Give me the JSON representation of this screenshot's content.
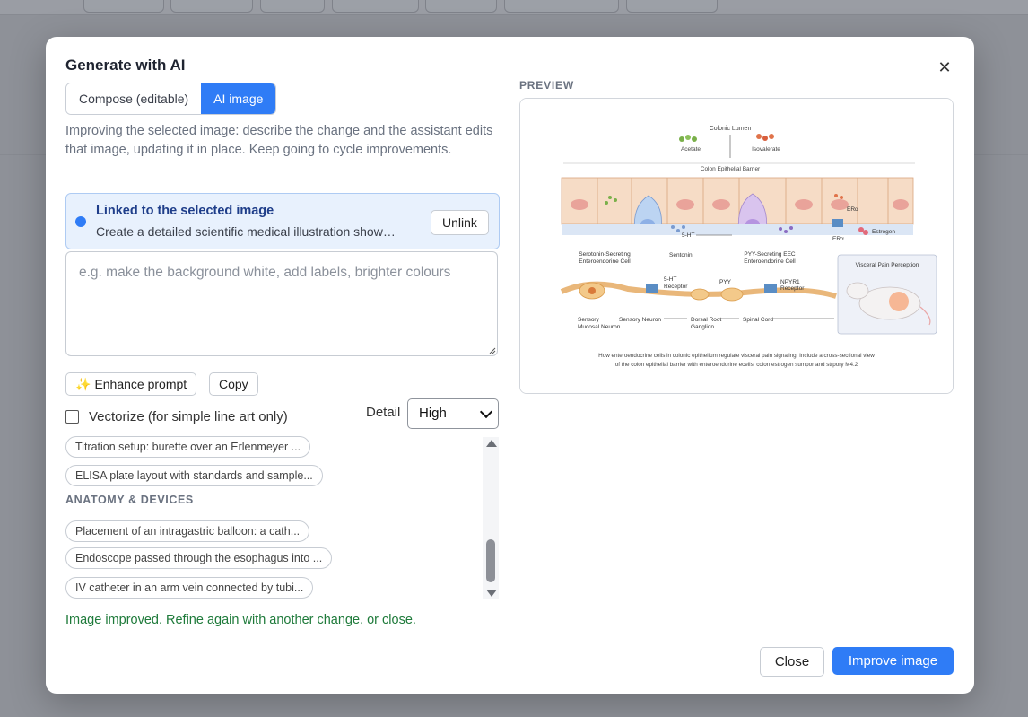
{
  "dialog": {
    "title": "Generate with AI",
    "close_icon": "close-icon",
    "tabs": [
      {
        "label": "Compose (editable)",
        "active": false
      },
      {
        "label": "AI image",
        "active": true
      }
    ],
    "description": "Improving the selected image: describe the change and the assistant edits that image, updating it in place. Keep going to cycle improvements.",
    "linked": {
      "title": "Linked to the selected image",
      "prompt_preview": "Create a detailed scientific medical illustration showing the role of enteroendocrine cells in colonic epithelium",
      "unlink_label": "Unlink"
    },
    "prompt_input": {
      "value": "",
      "placeholder": "e.g. make the background white, add labels, brighter colours"
    },
    "enhance_label": "Enhance prompt",
    "copy_label": "Copy",
    "vectorize": {
      "label": "Vectorize (for simple line art only)",
      "checked": false
    },
    "detail": {
      "label": "Detail",
      "value": "High"
    },
    "suggestions_top": [
      "Titration setup: burette over an Erlenmeyer ...",
      "ELISA plate layout with standards and sample..."
    ],
    "section_title": "ANATOMY & DEVICES",
    "suggestions_anatomy": [
      "Placement of an intragastric balloon: a cath...",
      "Endoscope passed through the esophagus into ...",
      "IV catheter in an arm vein connected by tubi..."
    ],
    "status": "Image improved. Refine again with another change, or close.",
    "preview_label": "PREVIEW",
    "close_label": "Close",
    "improve_label": "Improve image",
    "accent_color": "#2f7cf6",
    "success_color": "#1e7a3a"
  },
  "illustration": {
    "top_label": "Colonic Lumen",
    "scfa_left": "Acetate",
    "scfa_right": "Isovalerate",
    "barrier": "Colon Epithelial Barrier",
    "eec1": "Serotonin-Secreting",
    "eec1b": "Enteroendorine Cell",
    "eec2": "PYY-Secreting EEC",
    "eec2b": "Enteroendorine Cell",
    "serotonin": "Sentonin",
    "ht": "5-HT",
    "ht3": "5-HT",
    "ht3b": "Receptor",
    "pyy": "PYY",
    "npyr": "NPYR1",
    "npyrb": "Receptor",
    "er": "ERα",
    "er2": "ERα",
    "estrogen": "Estrogen",
    "sensory1": "Sensory",
    "sensory1b": "Mucosal Neuron",
    "sensory2": "Sensory Neuron",
    "drg": "Dorsal Root",
    "drgb": "Ganglion",
    "spinal": "Spinal Cord",
    "visceral": "Visceral Pain Perception",
    "caption1": "How enteroendocrine cells in colonic epithelium regulate visceral pain signaling. Include a cross-sectional view",
    "caption2": "of the colon epithelial barrier with enteroendorine ecells, colon estrogen sumpor and strpory M4.2"
  }
}
